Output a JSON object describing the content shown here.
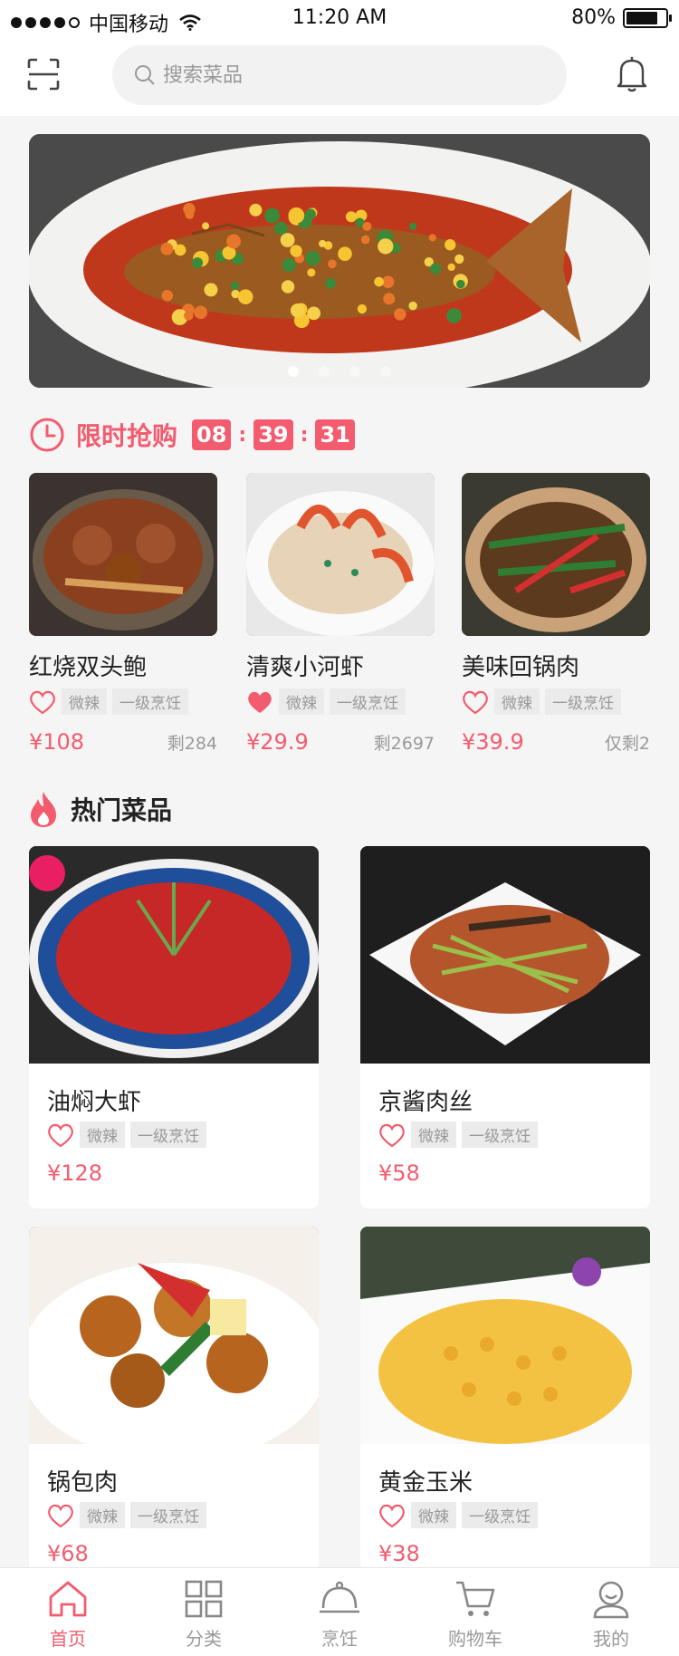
{
  "status_bar": {
    "carrier": "中国移动",
    "time": "11:20 AM",
    "battery": "80%",
    "battery_level": 0.8
  },
  "search": {
    "placeholder": "搜索菜品"
  },
  "banner": {
    "slides": 4,
    "active_slide": 1
  },
  "flash_sale": {
    "title": "限时抢购",
    "countdown": {
      "hours": "08",
      "minutes": "39",
      "seconds": "31"
    },
    "items": [
      {
        "name": "红烧双头鲍",
        "tags": [
          "微辣",
          "一级烹饪"
        ],
        "price": "¥108",
        "stock": "剩284",
        "favorited": false
      },
      {
        "name": "清爽小河虾",
        "tags": [
          "微辣",
          "一级烹饪"
        ],
        "price": "¥29.9",
        "stock": "剩2697",
        "favorited": true
      },
      {
        "name": "美味回锅肉",
        "tags": [
          "微辣",
          "一级烹饪"
        ],
        "price": "¥39.9",
        "stock": "仅剩2",
        "favorited": false
      }
    ]
  },
  "hot": {
    "title": "热门菜品",
    "items": [
      {
        "name": "油焖大虾",
        "tags": [
          "微辣",
          "一级烹饪"
        ],
        "price": "¥128"
      },
      {
        "name": "京酱肉丝",
        "tags": [
          "微辣",
          "一级烹饪"
        ],
        "price": "¥58"
      },
      {
        "name": "锅包肉",
        "tags": [
          "微辣",
          "一级烹饪"
        ],
        "price": "¥68"
      },
      {
        "name": "黄金玉米",
        "tags": [
          "微辣",
          "一级烹饪"
        ],
        "price": "¥38"
      }
    ]
  },
  "tabs": [
    {
      "label": "首页",
      "icon": "home-icon",
      "active": true
    },
    {
      "label": "分类",
      "icon": "grid-icon",
      "active": false
    },
    {
      "label": "烹饪",
      "icon": "cloche-icon",
      "active": false
    },
    {
      "label": "购物车",
      "icon": "cart-icon",
      "active": false
    },
    {
      "label": "我的",
      "icon": "user-icon",
      "active": false
    }
  ],
  "colors": {
    "accent": "#f35c6e",
    "tag_bg": "#ebebeb",
    "tag_text": "#999999",
    "page_bg": "#f5f5f5"
  }
}
